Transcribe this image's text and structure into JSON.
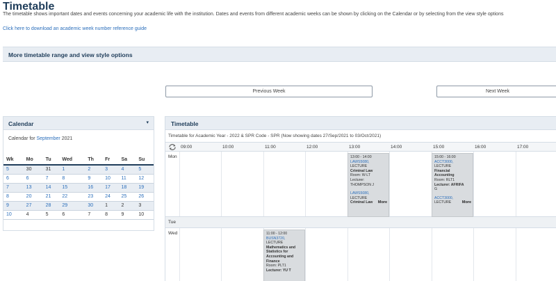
{
  "page": {
    "title": "Timetable",
    "intro": "The timetable shows important dates and events concerning your academic life with the institution. Dates and events from different academic weeks can be shown by clicking on the Calendar or by selecting from the view style options",
    "download_link": "Click here to download an academic week number reference guide"
  },
  "options": {
    "title": "More timetable range and view style options"
  },
  "nav": {
    "prev_label": "Previous Week",
    "next_label": "Next Week"
  },
  "calendar": {
    "title": "Calendar",
    "caret": "▾",
    "prefix": "Calendar for",
    "month": "September",
    "year": "2021",
    "headers": [
      "Wk",
      "Mo",
      "Tu",
      "Wed",
      "Th",
      "Fr",
      "Sa",
      "Su"
    ],
    "weeks": [
      [
        "5",
        "30",
        "31",
        "1",
        "2",
        "3",
        "4",
        "5"
      ],
      [
        "6",
        "6",
        "7",
        "8",
        "9",
        "10",
        "11",
        "12"
      ],
      [
        "7",
        "13",
        "14",
        "15",
        "16",
        "17",
        "18",
        "19"
      ],
      [
        "8",
        "20",
        "21",
        "22",
        "23",
        "24",
        "25",
        "26"
      ],
      [
        "9",
        "27",
        "28",
        "29",
        "30",
        "1",
        "2",
        "3"
      ],
      [
        "10",
        "4",
        "5",
        "6",
        "7",
        "8",
        "9",
        "10"
      ]
    ]
  },
  "timetable": {
    "title": "Timetable",
    "subtitle": "Timetable for Academic Year - 2022 & SPR Code - SPR (Now showing dates 27/Sep/2021 to 03/Oct/2021)",
    "times": [
      "09:00",
      "10:00",
      "11:00",
      "12:00",
      "13:00",
      "14:00",
      "15:00",
      "16:00",
      "17:00"
    ],
    "days": [
      "Mon",
      "Tue",
      "Wed"
    ],
    "more_label": "More",
    "events": [
      {
        "day": "Mon",
        "time": "13:00 - 14:00",
        "code": "LAWS5080,",
        "type": "LECTURE",
        "name": "Criminal Law",
        "room": "Room: W-LT",
        "lecturer_label": "Lecturer:",
        "lecturer": "THOMPSON J",
        "code2": "LAWS5080,",
        "type2": "LECTURE",
        "name2": "Criminal Law"
      },
      {
        "day": "Mon",
        "time": "15:00 - 16:00",
        "code": "ACCT3000,",
        "type": "LECTURE",
        "name": "Financial Accounting",
        "room": "Room: RLT1",
        "lecturer_label": "Lecturer: AFRIFA",
        "lecturer": "G",
        "code2": "ACCT3000,",
        "type2": "LECTURE"
      },
      {
        "day": "Wed",
        "time": "11:00 - 12:00",
        "code": "BUSN3720,",
        "type": "LECTURE",
        "name": "Mathematics and Statistics for Accounting and Finance",
        "room": "Room: PLT1",
        "lecturer_label": "Lecturer: YU T"
      }
    ]
  }
}
